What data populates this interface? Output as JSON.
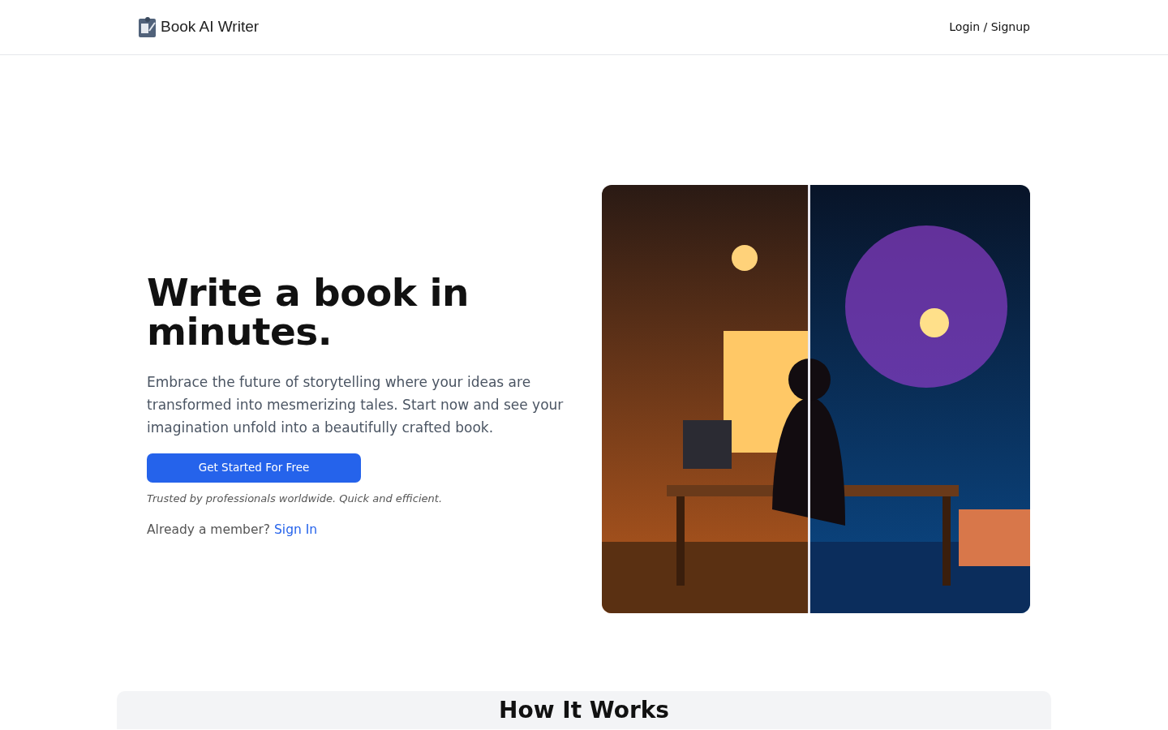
{
  "navbar": {
    "brand": "Book AI Writer",
    "login": "Login / Signup"
  },
  "hero": {
    "title": "Write a book in minutes.",
    "description": "Embrace the future of storytelling where your ideas are transformed into mesmerizing tales. Start now and see your imagination unfold into a beautifully crafted book.",
    "cta": "Get Started For Free",
    "trust_note": "Trusted by professionals worldwide. Quick and efficient.",
    "member_prompt": "Already a member?",
    "sign_in": "Sign In"
  },
  "how_it_works": {
    "title": "How It Works"
  }
}
